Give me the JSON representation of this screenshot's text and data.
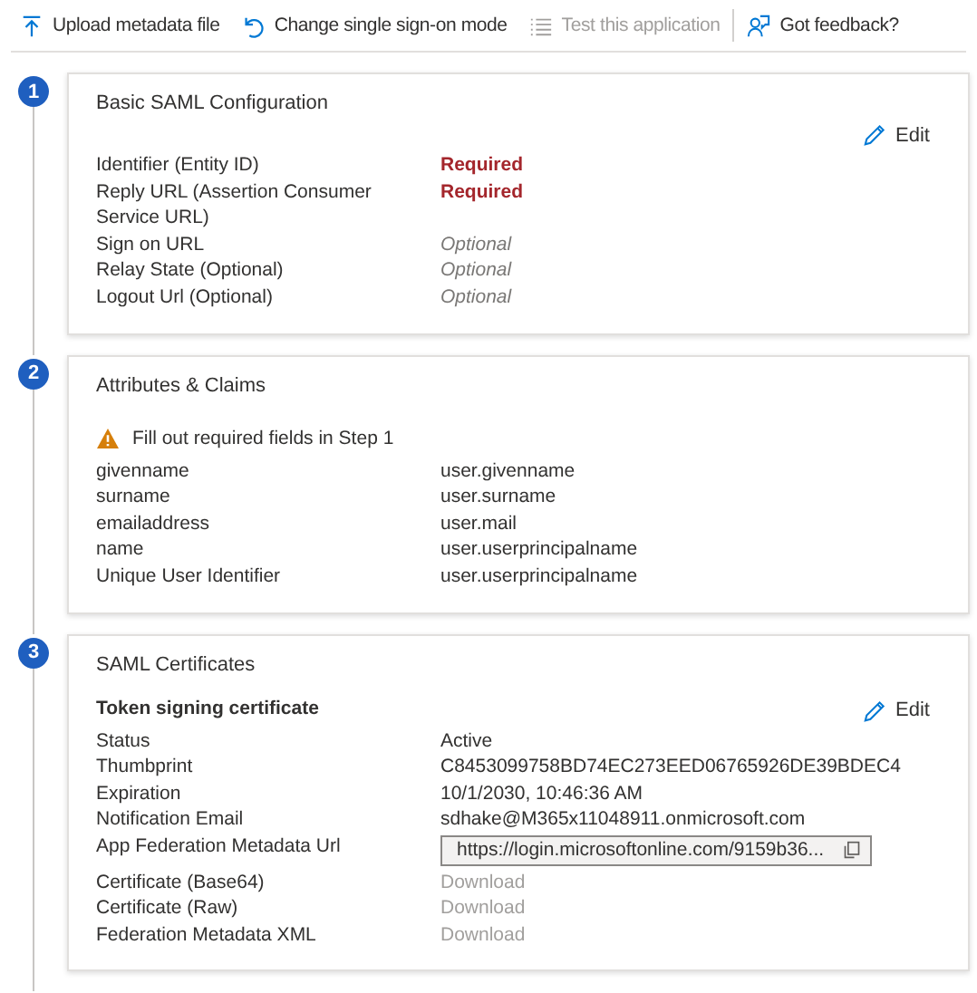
{
  "toolbar": [
    {
      "label": "Upload metadata file",
      "disabled": false
    },
    {
      "label": "Change single sign-on mode",
      "disabled": false
    },
    {
      "label": "Test this application",
      "disabled": true
    },
    {
      "label": "Got feedback?",
      "disabled": false
    }
  ],
  "steps": [
    {
      "number": "1",
      "title": "Basic SAML Configuration",
      "edit": "Edit",
      "rows": [
        {
          "label": "Identifier (Entity ID)",
          "value": "Required",
          "kind": "required"
        },
        {
          "label": "Reply URL (Assertion Consumer Service URL)",
          "value": "Required",
          "kind": "required"
        },
        {
          "label": "Sign on URL",
          "value": "Optional",
          "kind": "optional"
        },
        {
          "label": "Relay State (Optional)",
          "value": "Optional",
          "kind": "optional"
        },
        {
          "label": "Logout Url (Optional)",
          "value": "Optional",
          "kind": "optional"
        }
      ]
    },
    {
      "number": "2",
      "title": "Attributes & Claims",
      "warning": "Fill out required fields in Step 1",
      "rows": [
        {
          "label": "givenname",
          "value": "user.givenname",
          "kind": "text"
        },
        {
          "label": "surname",
          "value": "user.surname",
          "kind": "text"
        },
        {
          "label": "emailaddress",
          "value": "user.mail",
          "kind": "text"
        },
        {
          "label": "name",
          "value": "user.userprincipalname",
          "kind": "text"
        },
        {
          "label": "Unique User Identifier",
          "value": "user.userprincipalname",
          "kind": "text"
        }
      ]
    },
    {
      "number": "3",
      "title": "SAML Certificates",
      "subtitle": "Token signing certificate",
      "edit": "Edit",
      "rows": [
        {
          "label": "Status",
          "value": "Active",
          "kind": "text"
        },
        {
          "label": "Thumbprint",
          "value": "C8453099758BD74EC273EED06765926DE39BDEC4",
          "kind": "text"
        },
        {
          "label": "Expiration",
          "value": "10/1/2030, 10:46:36 AM",
          "kind": "text"
        },
        {
          "label": "Notification Email",
          "value": "sdhake@M365x11048911.onmicrosoft.com",
          "kind": "text"
        },
        {
          "label": "App Federation Metadata Url",
          "value": "https://login.microsoftonline.com/9159b36...",
          "kind": "field"
        },
        {
          "label": "Certificate (Base64)",
          "value": "Download",
          "kind": "download"
        },
        {
          "label": "Certificate (Raw)",
          "value": "Download",
          "kind": "download"
        },
        {
          "label": "Federation Metadata XML",
          "value": "Download",
          "kind": "download"
        }
      ]
    }
  ]
}
